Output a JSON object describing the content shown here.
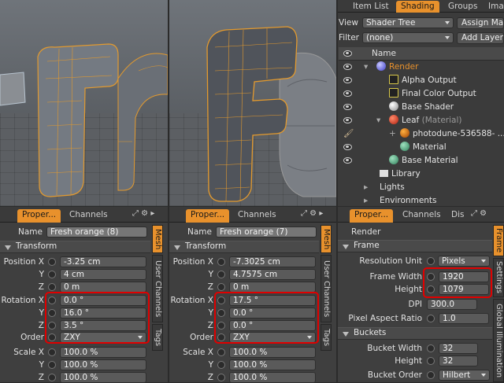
{
  "left_props": {
    "tabs": [
      "Proper...",
      "Channels"
    ],
    "name_label": "Name",
    "name_value": "Fresh orange (8)",
    "transform": "Transform",
    "pos_x": "Position X",
    "pos_x_val": "-3.25 cm",
    "y": "Y",
    "pos_y_val": "4 cm",
    "z": "Z",
    "pos_z_val": "0 m",
    "rot_x": "Rotation X",
    "rot_x_val": "0.0 °",
    "rot_y_val": "16.0 °",
    "rot_z_val": "3.5 °",
    "order": "Order",
    "order_val": "ZXY",
    "scale_x": "Scale X",
    "scale_x_val": "100.0 %",
    "scale_y_val": "100.0 %",
    "scale_z_val": "100.0 %",
    "vtabs": [
      "Mesh",
      "User Channels",
      "Tags"
    ]
  },
  "mid_props": {
    "tabs": [
      "Proper...",
      "Channels"
    ],
    "name_label": "Name",
    "name_value": "Fresh orange (7)",
    "transform": "Transform",
    "pos_x": "Position X",
    "pos_x_val": "-7.3025 cm",
    "y": "Y",
    "pos_y_val": "4.7575 cm",
    "z": "Z",
    "pos_z_val": "0 m",
    "rot_x": "Rotation X",
    "rot_x_val": "17.5 °",
    "rot_y_val": "0.0 °",
    "rot_z_val": "0.0 °",
    "order": "Order",
    "order_val": "ZXY",
    "scale_x": "Scale X",
    "scale_x_val": "100.0 %",
    "scale_y_val": "100.0 %",
    "scale_z_val": "100.0 %",
    "vtabs": [
      "Mesh",
      "User Channels",
      "Tags"
    ]
  },
  "shading": {
    "tabs": [
      "Item List",
      "Shading",
      "Groups",
      "Ima"
    ],
    "view_label": "View",
    "view_value": "Shader Tree",
    "assign_btn": "Assign Ma",
    "filter_label": "Filter",
    "filter_value": "(none)",
    "add_layer_btn": "Add Layer",
    "col_name": "Name",
    "rows": [
      {
        "label": "Render"
      },
      {
        "label": "Alpha Output"
      },
      {
        "label": "Final Color Output"
      },
      {
        "label": "Base Shader"
      },
      {
        "label": "Leaf",
        "suffix": "(Material)"
      },
      {
        "label": "photodune-536588- ..."
      },
      {
        "label": "Material"
      },
      {
        "label": "Base Material"
      },
      {
        "label": "Library"
      },
      {
        "label": "Lights"
      },
      {
        "label": "Environments"
      }
    ]
  },
  "render_props": {
    "tabs": [
      "Proper...",
      "Channels",
      "Dis"
    ],
    "render": "Render",
    "frame": "Frame",
    "res_unit": "Resolution Unit",
    "res_unit_val": "Pixels",
    "frame_width": "Frame Width",
    "frame_width_val": "1920",
    "height": "Height",
    "height_val": "1079",
    "dpi": "DPI",
    "dpi_val": "300.0",
    "pixel_aspect": "Pixel Aspect Ratio",
    "pixel_aspect_val": "1.0",
    "buckets": "Buckets",
    "bucket_width": "Bucket Width",
    "bucket_width_val": "32",
    "bucket_height": "Height",
    "bucket_height_val": "32",
    "bucket_order": "Bucket Order",
    "bucket_order_val": "Hilbert",
    "vtabs": [
      "Frame",
      "Settings",
      "Global Illumination"
    ]
  },
  "colors": {
    "accent": "#e8912c",
    "highlight": "#e00000"
  }
}
